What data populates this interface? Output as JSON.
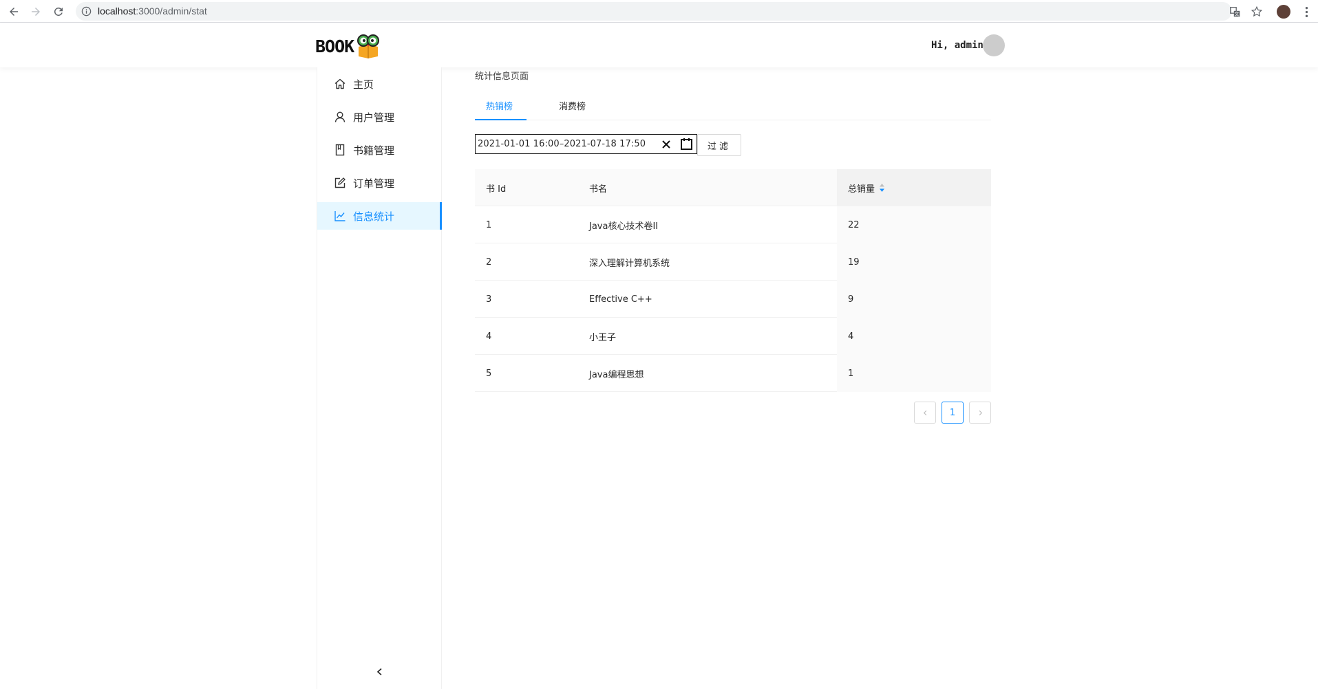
{
  "browser": {
    "url_host": "localhost",
    "url_path": ":3000/admin/stat"
  },
  "header": {
    "logo_text": "BOOK",
    "greeting": "Hi, admin"
  },
  "sidebar": {
    "items": [
      {
        "label": "主页",
        "icon": "home-icon"
      },
      {
        "label": "用户管理",
        "icon": "user-icon"
      },
      {
        "label": "书籍管理",
        "icon": "book-icon"
      },
      {
        "label": "订单管理",
        "icon": "edit-icon"
      },
      {
        "label": "信息统计",
        "icon": "line-chart-icon",
        "active": true
      }
    ]
  },
  "main": {
    "page_title": "统计信息页面",
    "tabs": [
      {
        "label": "热销榜",
        "active": true
      },
      {
        "label": "消费榜",
        "active": false
      }
    ],
    "range": {
      "start": "2021-01-01 16:00",
      "separator": "–",
      "end": "2021-07-18 17:50"
    },
    "filter_label": "过滤",
    "table": {
      "columns": [
        "书 Id",
        "书名",
        "总销量"
      ],
      "rows": [
        {
          "id": "1",
          "name": "Java核心技术卷II",
          "sales": "22"
        },
        {
          "id": "2",
          "name": "深入理解计算机系统",
          "sales": "19"
        },
        {
          "id": "3",
          "name": "Effective C++",
          "sales": "9"
        },
        {
          "id": "4",
          "name": "小王子",
          "sales": "4"
        },
        {
          "id": "5",
          "name": "Java编程思想",
          "sales": "1"
        }
      ]
    },
    "pagination": {
      "current": "1"
    }
  },
  "colors": {
    "accent": "#1890ff",
    "active_bg": "#e6f7ff",
    "border": "#f0f0f0"
  }
}
